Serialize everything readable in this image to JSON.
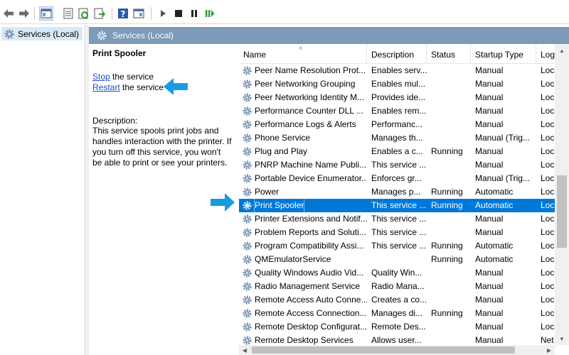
{
  "tree": {
    "root_label": "Services (Local)"
  },
  "panel": {
    "title": "Services (Local)"
  },
  "details": {
    "service_name": "Print Spooler",
    "stop_link": "Stop",
    "stop_suffix": " the service",
    "restart_link": "Restart",
    "restart_suffix": " the service",
    "description_label": "Description:",
    "description_text": "This service spools print jobs and handles interaction with the printer. If you turn off this service, you won't be able to print or see your printers."
  },
  "columns": [
    "Name",
    "Description",
    "Status",
    "Startup Type",
    "Log"
  ],
  "rows": [
    {
      "name": "Peer Name Resolution Prot...",
      "description": "Enables serv...",
      "status": "",
      "startup": "Manual",
      "log": "Loc"
    },
    {
      "name": "Peer Networking Grouping",
      "description": "Enables mul...",
      "status": "",
      "startup": "Manual",
      "log": "Loc"
    },
    {
      "name": "Peer Networking Identity M...",
      "description": "Provides ide...",
      "status": "",
      "startup": "Manual",
      "log": "Loc"
    },
    {
      "name": "Performance Counter DLL ...",
      "description": "Enables rem...",
      "status": "",
      "startup": "Manual",
      "log": "Loc"
    },
    {
      "name": "Performance Logs & Alerts",
      "description": "Performanc...",
      "status": "",
      "startup": "Manual",
      "log": "Loc"
    },
    {
      "name": "Phone Service",
      "description": "Manages th...",
      "status": "",
      "startup": "Manual (Trig...",
      "log": "Loc"
    },
    {
      "name": "Plug and Play",
      "description": "Enables a c...",
      "status": "Running",
      "startup": "Manual",
      "log": "Loc"
    },
    {
      "name": "PNRP Machine Name Publi...",
      "description": "This service ...",
      "status": "",
      "startup": "Manual",
      "log": "Loc"
    },
    {
      "name": "Portable Device Enumerator...",
      "description": "Enforces gr...",
      "status": "",
      "startup": "Manual (Trig...",
      "log": "Loc"
    },
    {
      "name": "Power",
      "description": "Manages p...",
      "status": "Running",
      "startup": "Automatic",
      "log": "Loc"
    },
    {
      "name": "Print Spooler",
      "description": "This service ...",
      "status": "Running",
      "startup": "Automatic",
      "log": "Loc",
      "selected": true
    },
    {
      "name": "Printer Extensions and Notif...",
      "description": "This service ...",
      "status": "",
      "startup": "Manual",
      "log": "Loc"
    },
    {
      "name": "Problem Reports and Soluti...",
      "description": "This service ...",
      "status": "",
      "startup": "Manual",
      "log": "Loc"
    },
    {
      "name": "Program Compatibility Assi...",
      "description": "This service ...",
      "status": "Running",
      "startup": "Automatic",
      "log": "Loc"
    },
    {
      "name": "QMEmulatorService",
      "description": "",
      "status": "Running",
      "startup": "Automatic",
      "log": "Loc"
    },
    {
      "name": "Quality Windows Audio Vid...",
      "description": "Quality Win...",
      "status": "",
      "startup": "Manual",
      "log": "Loc"
    },
    {
      "name": "Radio Management Service",
      "description": "Radio Mana...",
      "status": "",
      "startup": "Manual",
      "log": "Loc"
    },
    {
      "name": "Remote Access Auto Conne...",
      "description": "Creates a co...",
      "status": "",
      "startup": "Manual",
      "log": "Loc"
    },
    {
      "name": "Remote Access Connection...",
      "description": "Manages di...",
      "status": "Running",
      "startup": "Manual",
      "log": "Loc"
    },
    {
      "name": "Remote Desktop Configurat...",
      "description": "Remote Des...",
      "status": "",
      "startup": "Manual",
      "log": "Loc"
    },
    {
      "name": "Remote Desktop Services",
      "description": "Allows user...",
      "status": "",
      "startup": "Manual",
      "log": "Net"
    }
  ],
  "icons": {
    "service": "gear-icon",
    "toolbar": [
      "back-arrow-icon",
      "forward-arrow-icon",
      "show-hide-console-tree-icon",
      "properties-icon",
      "refresh-icon",
      "export-list-icon",
      "help-icon",
      "show-hide-action-pane-icon",
      "start-service-icon",
      "stop-service-icon",
      "pause-service-icon",
      "restart-service-icon"
    ]
  },
  "colors": {
    "selection": "#0078d7",
    "header_bar": "#7c9ab9",
    "annotation_arrow": "#1a9be0",
    "link": "#1f4fbf"
  }
}
